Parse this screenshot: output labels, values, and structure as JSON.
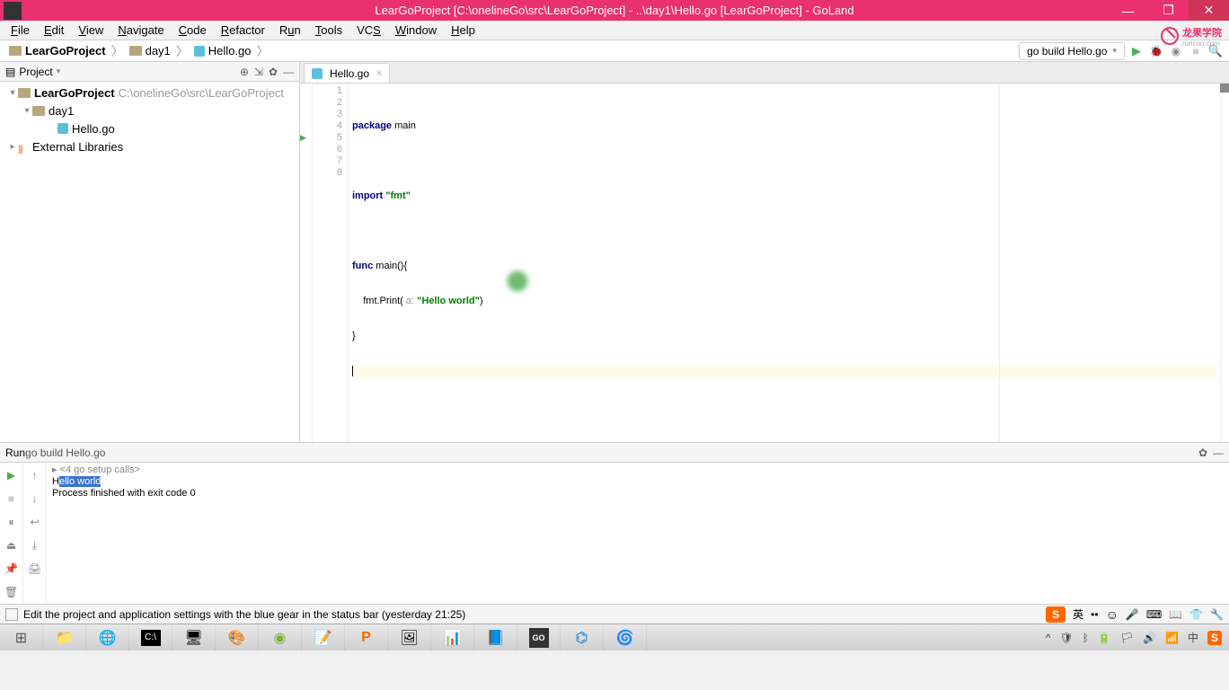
{
  "titlebar": {
    "title": "LearGoProject [C:\\onelineGo\\src\\LearGoProject] - ..\\day1\\Hello.go [LearGoProject] - GoLand"
  },
  "menubar": {
    "items": [
      "File",
      "Edit",
      "View",
      "Navigate",
      "Code",
      "Refactor",
      "Run",
      "Tools",
      "VCS",
      "Window",
      "Help"
    ]
  },
  "logo_text": "龙果学院",
  "logo_sub": "roncoo.com",
  "breadcrumb": {
    "items": [
      "LearGoProject",
      "day1",
      "Hello.go"
    ]
  },
  "run_config": "go build Hello.go",
  "project_panel": {
    "title": "Project",
    "root": {
      "name": "LearGoProject",
      "path": "C:\\onelineGo\\src\\LearGoProject"
    },
    "folder": "day1",
    "file": "Hello.go",
    "external": "External Libraries"
  },
  "editor": {
    "tab": "Hello.go",
    "lines": {
      "l1_kw": "package",
      "l1_ident": " main",
      "l3_kw": "import",
      "l3_str": " \"fmt\"",
      "l5_kw": "func",
      "l5_ident": " main(){",
      "l6_indent": "    fmt.Print( ",
      "l6_param": "a:",
      "l6_str": " \"Hello world\"",
      "l6_close": ")",
      "l7": "}",
      "l8": ""
    }
  },
  "run_panel": {
    "title_prefix": "Run   ",
    "title_config": "go build Hello.go",
    "out1_prefix": "▸ ",
    "out1": "<4 go setup calls>",
    "out2_prefix": "H",
    "out2_hl": "ello world",
    "out3": "Process finished with exit code 0"
  },
  "statusbar": {
    "text": "Edit the project and application settings with the blue gear in the status bar (yesterday 21:25)",
    "ime_lang": "英"
  }
}
